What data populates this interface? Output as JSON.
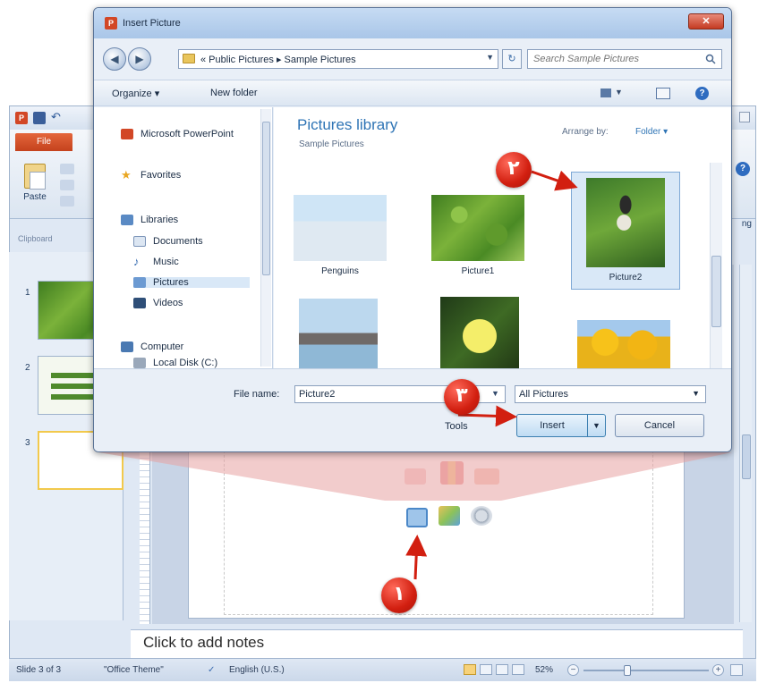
{
  "powerpoint": {
    "file_tab": "File",
    "paste_label": "Paste",
    "clipboard_label": "Clipboard",
    "ribbon_partial_text": "ng",
    "notes_placeholder": "Click to add notes",
    "thumbnails": [
      "1",
      "2",
      "3"
    ],
    "status": {
      "slide": "Slide 3 of 3",
      "theme": "\"Office Theme\"",
      "language": "English (U.S.)",
      "zoom": "52%",
      "zoom_level_fraction": 0.35
    }
  },
  "dialog": {
    "title": "Insert Picture",
    "close_label": "✕",
    "address": {
      "path": "« Public Pictures ▸ Sample Pictures"
    },
    "search_placeholder": "Search Sample Pictures",
    "toolbar": {
      "organize": "Organize ▾",
      "new_folder": "New folder"
    },
    "nav_items": [
      {
        "label": "Microsoft PowerPoint",
        "icon": "powerpoint-icon"
      },
      {
        "label": "Favorites",
        "icon": "star-icon"
      },
      {
        "label": "Libraries",
        "icon": "library-icon"
      },
      {
        "label": "Documents",
        "icon": "documents-icon"
      },
      {
        "label": "Music",
        "icon": "music-icon"
      },
      {
        "label": "Pictures",
        "icon": "pictures-icon"
      },
      {
        "label": "Videos",
        "icon": "videos-icon"
      },
      {
        "label": "Computer",
        "icon": "computer-icon"
      },
      {
        "label": "Local Disk (C:)",
        "icon": "disk-icon"
      }
    ],
    "library": {
      "title": "Pictures library",
      "subtitle": "Sample Pictures",
      "arrange_label": "Arrange by:",
      "arrange_value": "Folder ▾"
    },
    "pictures": [
      {
        "label": "Penguins"
      },
      {
        "label": "Picture1"
      },
      {
        "label": "Picture2",
        "selected": true
      },
      {
        "label": ""
      },
      {
        "label": ""
      },
      {
        "label": ""
      }
    ],
    "footer": {
      "file_name_label": "File name:",
      "file_name_value": "Picture2",
      "file_type": "All Pictures",
      "tools": "Tools",
      "insert": "Insert",
      "cancel": "Cancel"
    }
  },
  "markers": {
    "step1": "۱",
    "step2": "۲",
    "step3": "۳"
  },
  "colors": {
    "marker_red": "#d21f10",
    "accent_blue": "#2e74b5",
    "file_tab_orange": "#d24726"
  }
}
